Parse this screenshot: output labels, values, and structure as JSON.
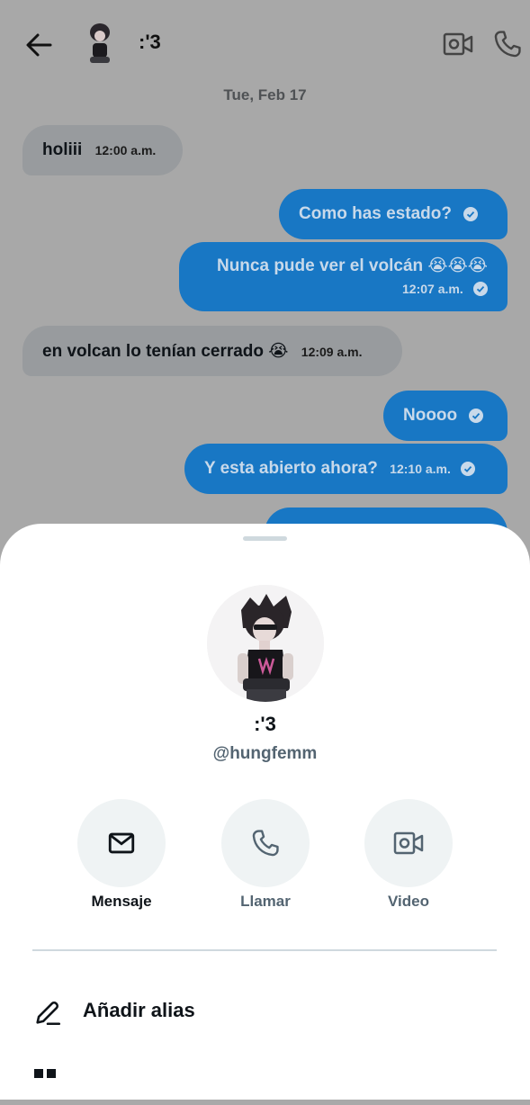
{
  "header": {
    "contact_name": ":'3",
    "date_separator": "Tue, Feb 17"
  },
  "messages": [
    {
      "direction": "in",
      "text": "holiii",
      "time": "12:00 a.m."
    },
    {
      "direction": "out",
      "text": "Como has estado?",
      "time": ""
    },
    {
      "direction": "out",
      "text": "Nunca pude ver el volcán 😭😭😭",
      "time": "12:07 a.m."
    },
    {
      "direction": "in",
      "text": "en volcan lo tenían cerrado 😭",
      "time": "12:09 a.m."
    },
    {
      "direction": "out",
      "text": "Noooo",
      "time": ""
    },
    {
      "direction": "out",
      "text": "Y esta abierto ahora?",
      "time": "12:10 a.m."
    }
  ],
  "sheet": {
    "name": ":'3",
    "handle": "@hungfemm",
    "actions": {
      "message": "Mensaje",
      "call": "Llamar",
      "video": "Video"
    },
    "menu": {
      "add_alias": "Añadir alias"
    }
  },
  "colors": {
    "outgoing_bubble": "#1877c4",
    "incoming_bubble": "#989b9e",
    "overlay_bg": "#a8a8a8",
    "sheet_bg": "#ffffff",
    "action_circle": "#eff3f4",
    "secondary_text": "#536471"
  },
  "icons": [
    "back-arrow-icon",
    "video-camera-icon",
    "phone-icon",
    "mail-icon",
    "pencil-icon",
    "check-circle-icon"
  ]
}
